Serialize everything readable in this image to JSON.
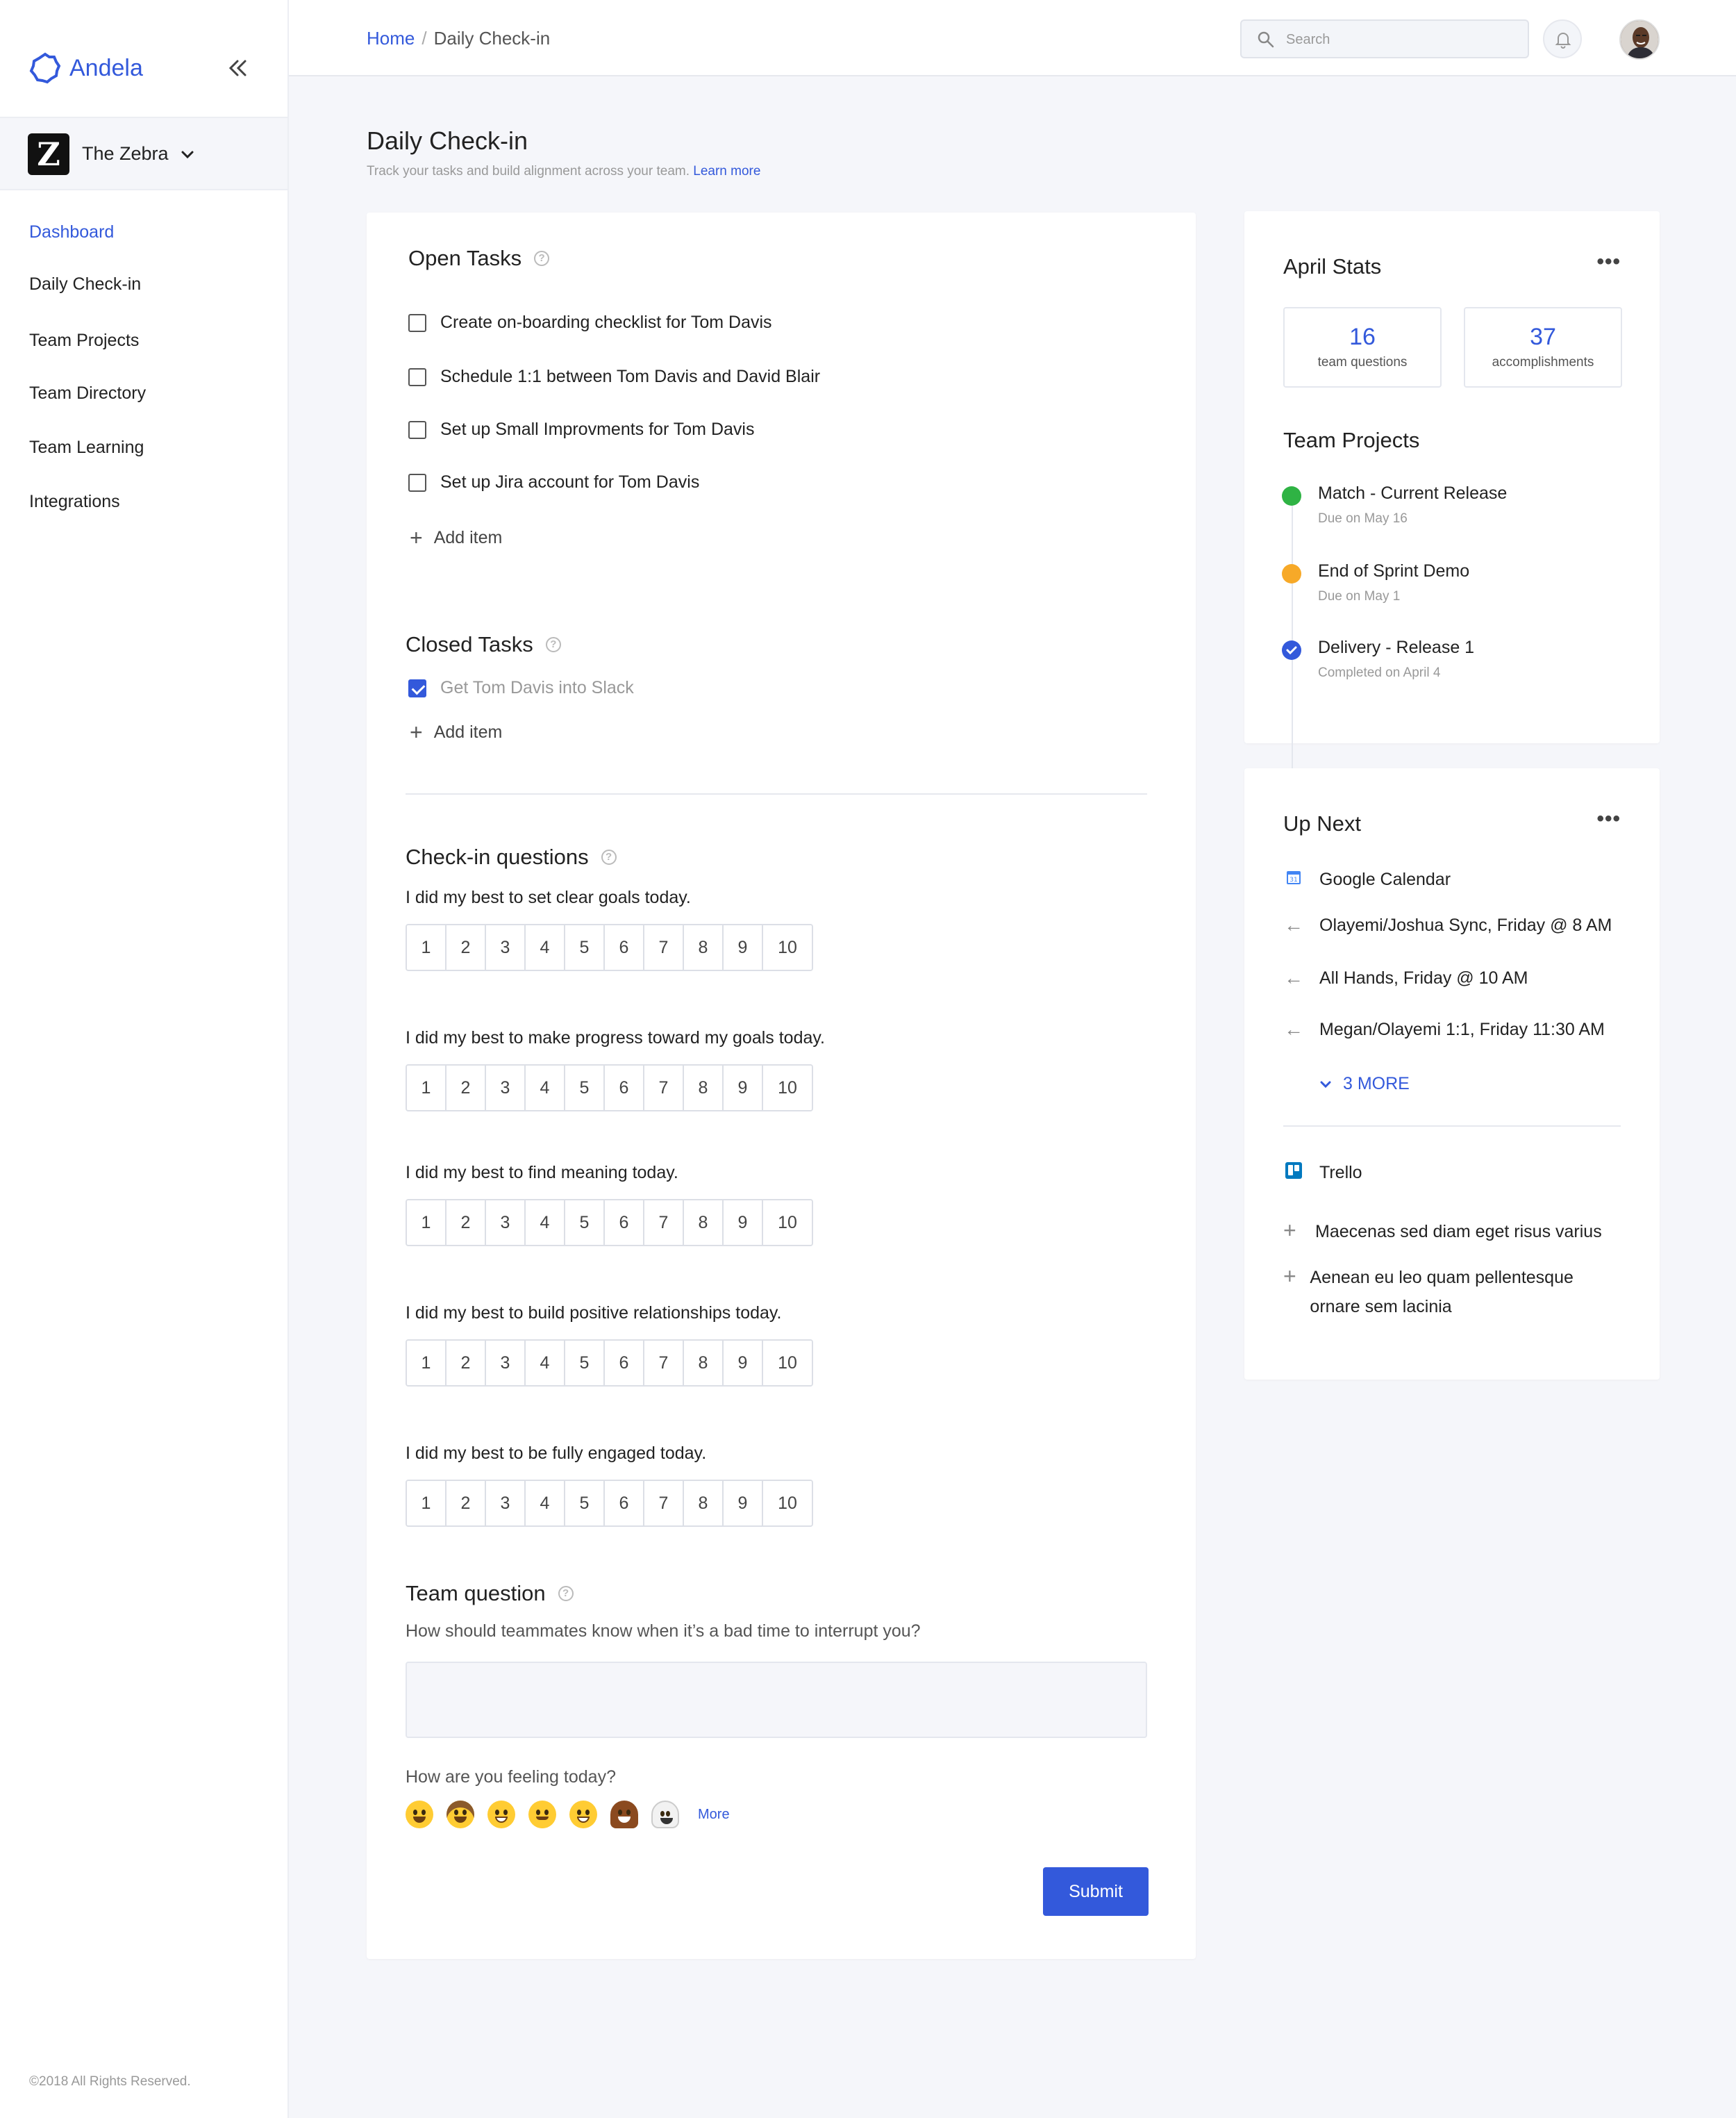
{
  "brand": {
    "name": "Andela",
    "accent": "#3359db"
  },
  "org": {
    "name": "The Zebra",
    "logo_letter": "Z"
  },
  "nav": [
    {
      "label": "Dashboard",
      "active": true
    },
    {
      "label": "Daily Check-in"
    },
    {
      "label": "Team Projects"
    },
    {
      "label": "Team Directory"
    },
    {
      "label": "Team Learning"
    },
    {
      "label": "Integrations"
    }
  ],
  "footer": {
    "copyright": "©2018 All Rights Reserved."
  },
  "topbar": {
    "breadcrumb": {
      "home": "Home",
      "separator": "/",
      "current": "Daily Check-in"
    },
    "search_placeholder": "Search"
  },
  "page": {
    "title": "Daily Check-in",
    "subtitle": "Track your tasks and build alignment across your team.",
    "learn_more": "Learn more"
  },
  "open_tasks": {
    "title": "Open Tasks",
    "items": [
      "Create on-boarding checklist for Tom Davis",
      "Schedule 1:1 between Tom Davis and David Blair",
      "Set up Small Improvments for Tom Davis",
      "Set up Jira account for Tom Davis"
    ],
    "add_label": "Add item"
  },
  "closed_tasks": {
    "title": "Closed Tasks",
    "items": [
      "Get Tom Davis into Slack"
    ],
    "add_label": "Add item"
  },
  "checkin": {
    "title": "Check-in questions",
    "scale": [
      "1",
      "2",
      "3",
      "4",
      "5",
      "6",
      "7",
      "8",
      "9",
      "10"
    ],
    "questions": [
      "I did my best to set clear goals today.",
      "I did my best to make progress toward my goals today.",
      "I did my best to find meaning today.",
      "I did my best to build positive relationships today.",
      "I did my best to be fully engaged today."
    ]
  },
  "team_question": {
    "title": "Team question",
    "text": "How should teammates know when it’s a bad time to interrupt you?",
    "answer": ""
  },
  "feeling": {
    "label": "How are you feeling today?",
    "emojis": [
      "grinning-face",
      "cowboy-face",
      "beaming-face",
      "sunglasses-face",
      "nerd-face",
      "pile-of-poo",
      "ghost"
    ],
    "more_label": "More"
  },
  "submit_label": "Submit",
  "stats": {
    "title": "April Stats",
    "items": [
      {
        "value": "16",
        "label": "team questions"
      },
      {
        "value": "37",
        "label": "accomplishments"
      }
    ]
  },
  "team_projects": {
    "title": "Team Projects",
    "items": [
      {
        "name": "Match - Current Release",
        "due": "Due on May 16",
        "status_color": "#2fb344"
      },
      {
        "name": "End of Sprint Demo",
        "due": "Due on May 1",
        "status_color": "#f7a928"
      },
      {
        "name": "Delivery - Release 1",
        "due": "Completed on April 4",
        "status_color": "#3359db"
      }
    ]
  },
  "up_next": {
    "title": "Up Next",
    "calendar": {
      "name": "Google Calendar",
      "events": [
        "Olayemi/Joshua Sync, Friday @ 8 AM",
        "All Hands, Friday @ 10 AM",
        "Megan/Olayemi 1:1, Friday 11:30 AM"
      ],
      "more_label": "3 MORE"
    },
    "trello": {
      "name": "Trello",
      "items": [
        "Maecenas sed diam eget risus varius",
        "Aenean eu leo quam pellentesque ornare sem lacinia"
      ]
    }
  }
}
